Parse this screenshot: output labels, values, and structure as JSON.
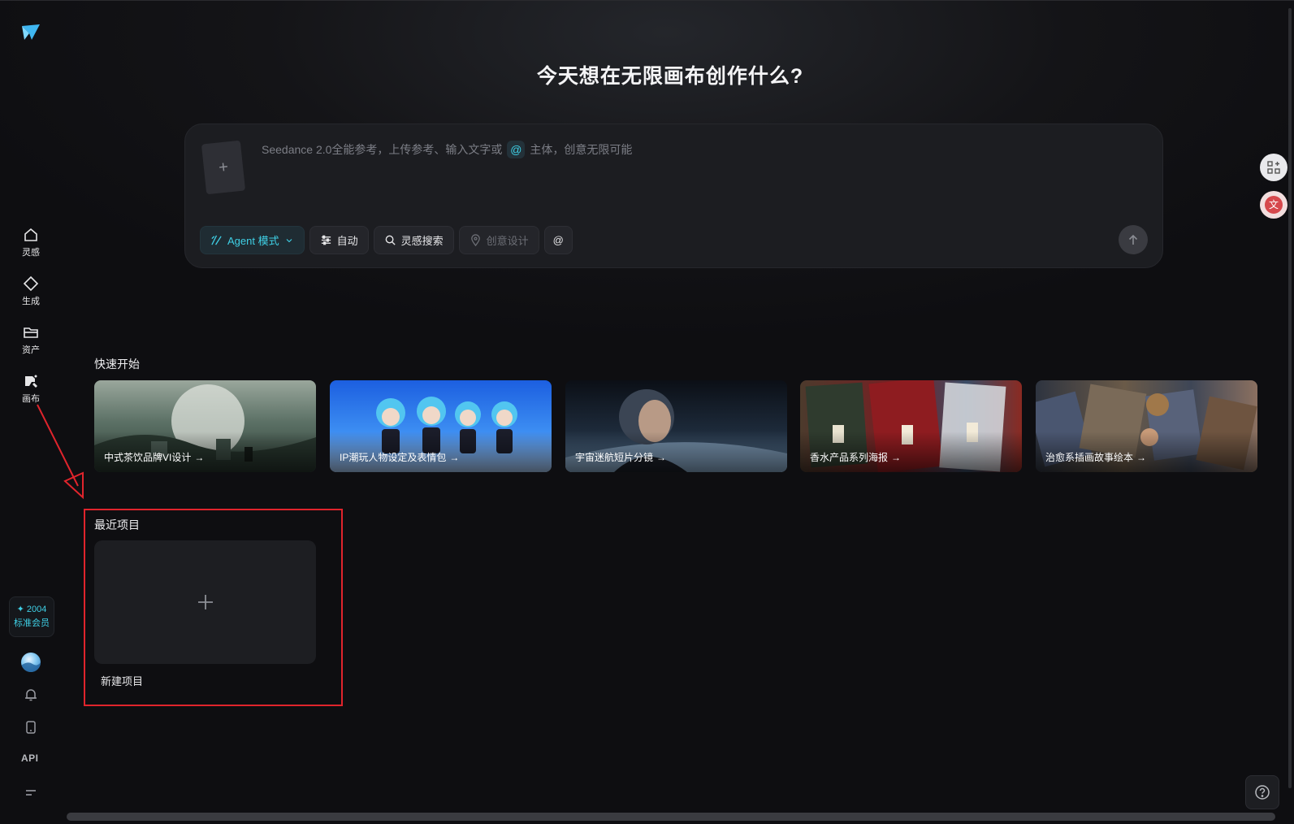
{
  "sidebar": {
    "nav": [
      {
        "label": "灵感",
        "icon": "home-icon"
      },
      {
        "label": "生成",
        "icon": "diamond-icon"
      },
      {
        "label": "资产",
        "icon": "folder-icon"
      },
      {
        "label": "画布",
        "icon": "canvas-icon"
      }
    ],
    "credits": {
      "value": "✦ 2004",
      "tier": "标准会员"
    },
    "api_label": "API"
  },
  "main": {
    "headline": "今天想在无限画布创作什么?",
    "prompt": {
      "placeholder_before": "Seedance 2.0全能参考，上传参考、输入文字或",
      "at_symbol": "@",
      "placeholder_after": "主体，创意无限可能",
      "ref_plus": "+",
      "toolbar": {
        "agent_mode": "Agent 模式",
        "auto": "自动",
        "inspiration_search": "灵感搜索",
        "creative_design": "创意设计",
        "mention": "@"
      }
    },
    "quick_start": {
      "title": "快速开始",
      "cards": [
        {
          "label": "中式茶饮品牌VI设计"
        },
        {
          "label": "IP潮玩人物设定及表情包"
        },
        {
          "label": "宇宙迷航短片分镜"
        },
        {
          "label": "香水产品系列海报"
        },
        {
          "label": "治愈系插画故事绘本"
        }
      ]
    },
    "recent": {
      "title": "最近项目",
      "new_project_plus": "+",
      "new_project_label": "新建项目"
    }
  },
  "colors": {
    "accent": "#3fd0e6",
    "background": "#0e0e11",
    "annotation_red": "#e0242c"
  }
}
